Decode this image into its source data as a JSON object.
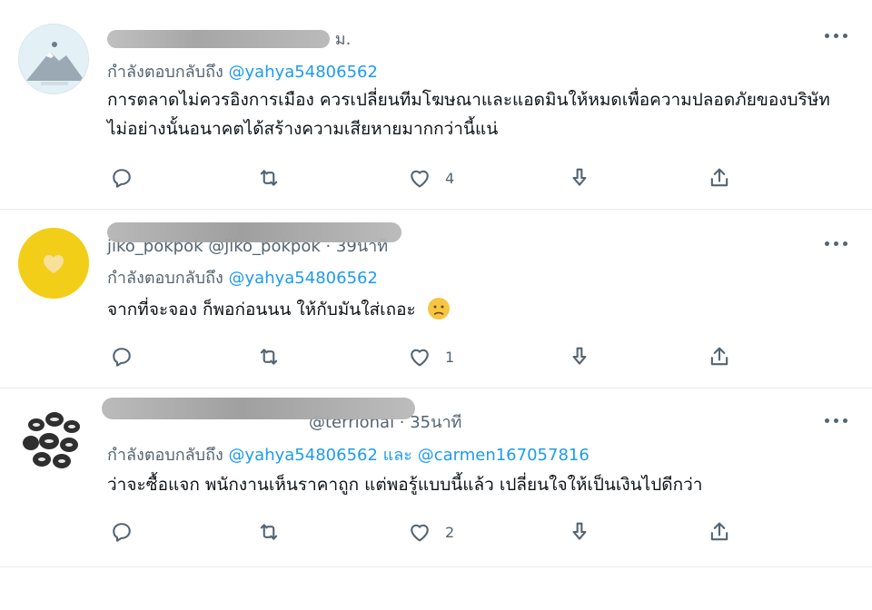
{
  "tweets": [
    {
      "header_text": "ม.",
      "replying_prefix": "กำลังตอบกลับถึง",
      "mentions": [
        "@yahya54806562"
      ],
      "body": "การตลาดไม่ควรอิงการเมือง ควรเปลี่ยนทีมโฆษณาและแอดมินให้หมดเพื่อความปลอดภัยของบริษัท ไม่อย่างนั้นอนาคตได้สร้างความเสียหายมากกว่านี้แน่",
      "likes": "4",
      "avatar_icon": "mountain-icon"
    },
    {
      "header_text": "jiko_pokpok @jiko_pokpok · 39นาที",
      "replying_prefix": "กำลังตอบกลับถึง",
      "mentions": [
        "@yahya54806562"
      ],
      "body": "จากที่จะจอง ก็พอก่อนนน ให้กับมันใส่เถอะ",
      "likes": "1",
      "avatar_icon": "heart-icon"
    },
    {
      "header_text": "@terrionai · 35นาที",
      "replying_prefix": "กำลังตอบกลับถึง",
      "mentions": [
        "@yahya54806562",
        "@carmen167057816"
      ],
      "mention_joiner": "และ",
      "body": "ว่าจะซื้อแจก พนักงานเห็นราคาถูก แต่พอรู้แบบนี้แล้ว เปลี่ยนใจให้เป็นเงินไปดีกว่า",
      "likes": "2",
      "avatar_icon": "shells-icon"
    }
  ],
  "colors": {
    "link": "#1d9bf0",
    "muted": "#536471",
    "text": "#0f1419",
    "divider": "#e6ecf0"
  }
}
